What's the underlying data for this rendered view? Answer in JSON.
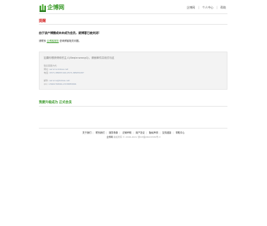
{
  "header": {
    "logo_text": "企博网",
    "nav": [
      "企博网",
      "个人中心",
      "帮助"
    ]
  },
  "main": {
    "notice_title": "提醒",
    "question": "由于该户博圈成未未成为会员，就博客已被关闭!",
    "tip_prefix": "请联系",
    "tip_link": "企博客服务",
    "tip_suffix": "咨询博客相关问题。",
    "box": {
      "title": "如果你想获得你的主人(BeqlanwangQ)，请就邮件并用式与这",
      "lines": [
        {
          "label": "联系客服方式:",
          "value": ""
        },
        {
          "label": "网址: ",
          "value": "service.bokee.net"
        },
        {
          "label": "电话: ",
          "value": "0571-88955190,0571-88955287"
        },
        {
          "label": "邮件: ",
          "value": "service@bokee.net"
        },
        {
          "label": "QQ: ",
          "value": "1396276896,1333885896"
        }
      ]
    },
    "green_heading": "我要升级成为 正式会员"
  },
  "footer": {
    "nav": [
      "关于我们",
      "联系我们",
      "服务条款",
      "法律声明",
      "用户协议",
      "隐私声明",
      "友情链接",
      "帮助中心"
    ],
    "brand": "企博网",
    "copyright": "版权所有 © 2006-2021",
    "icp": "浙ICP备06021584号-3"
  }
}
